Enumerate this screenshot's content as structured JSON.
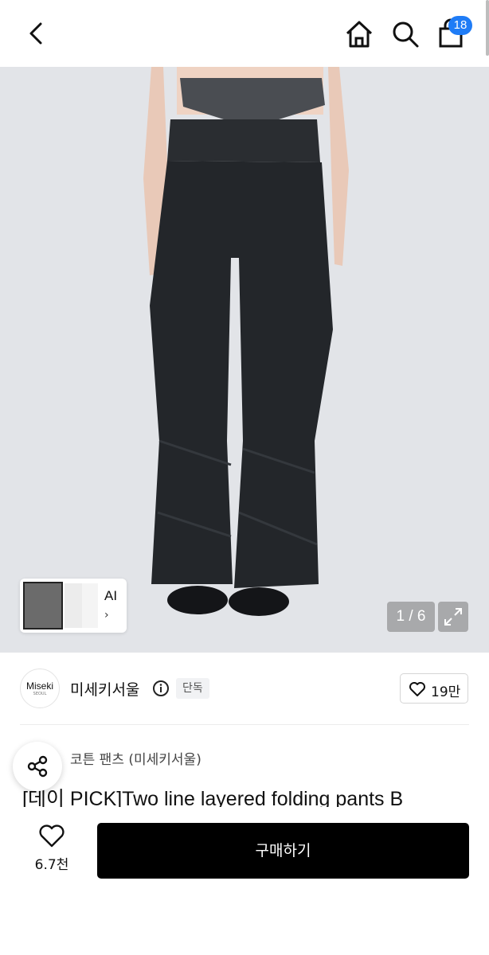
{
  "header": {
    "cart_count": "18"
  },
  "gallery": {
    "counter": "1 / 6",
    "thumb_label": "AI",
    "thumb_arrow": "›"
  },
  "seller": {
    "logo_text": "Miseki",
    "logo_sub": "SEOUL",
    "name": "미세키서울",
    "badge": "단독",
    "likes": "19만"
  },
  "product": {
    "category": "코튼 팬츠 (미세키서울)",
    "title": "[데이 PICK]Two line layered folding pants B"
  },
  "bottom": {
    "wish_count": "6.7천",
    "buy_label": "구매하기"
  },
  "colors": {
    "accent": "#1f7cf6",
    "buy": "#000000",
    "hero_bg": "#e2e4e8",
    "pants": "#23262a"
  }
}
